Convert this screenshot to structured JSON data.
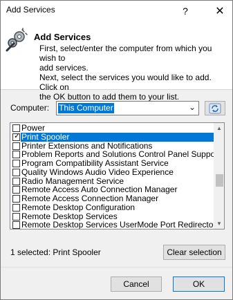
{
  "window": {
    "title": "Add Services",
    "help_label": "?",
    "close_label": "✕"
  },
  "header": {
    "title": "Add Services",
    "description_lines": [
      "First, select/enter the computer from which you wish to",
      "add services.",
      "Next, select the services you would like to add. Click on",
      "the OK button to add them to your list."
    ],
    "icon": "services-gear-icon"
  },
  "computer": {
    "label": "Computer:",
    "value": "This Computer",
    "refresh_icon": "refresh-icon"
  },
  "services": [
    {
      "label": "Power",
      "checked": false,
      "selected": false
    },
    {
      "label": "Print Spooler",
      "checked": true,
      "selected": true
    },
    {
      "label": "Printer Extensions and Notifications",
      "checked": false,
      "selected": false
    },
    {
      "label": "Problem Reports and Solutions Control Panel Support",
      "checked": false,
      "selected": false
    },
    {
      "label": "Program Compatibility Assistant Service",
      "checked": false,
      "selected": false
    },
    {
      "label": "Quality Windows Audio Video Experience",
      "checked": false,
      "selected": false
    },
    {
      "label": "Radio Management Service",
      "checked": false,
      "selected": false
    },
    {
      "label": "Remote Access Auto Connection Manager",
      "checked": false,
      "selected": false
    },
    {
      "label": "Remote Access Connection Manager",
      "checked": false,
      "selected": false
    },
    {
      "label": "Remote Desktop Configuration",
      "checked": false,
      "selected": false
    },
    {
      "label": "Remote Desktop Services",
      "checked": false,
      "selected": false
    },
    {
      "label": "Remote Desktop Services UserMode Port Redirector",
      "checked": false,
      "selected": false
    }
  ],
  "status": {
    "text": "1 selected: Print Spooler"
  },
  "buttons": {
    "clear": "Clear selection",
    "cancel": "Cancel",
    "ok": "OK"
  },
  "colors": {
    "selection": "#0078d7",
    "window_bg": "#f0f0f0"
  }
}
